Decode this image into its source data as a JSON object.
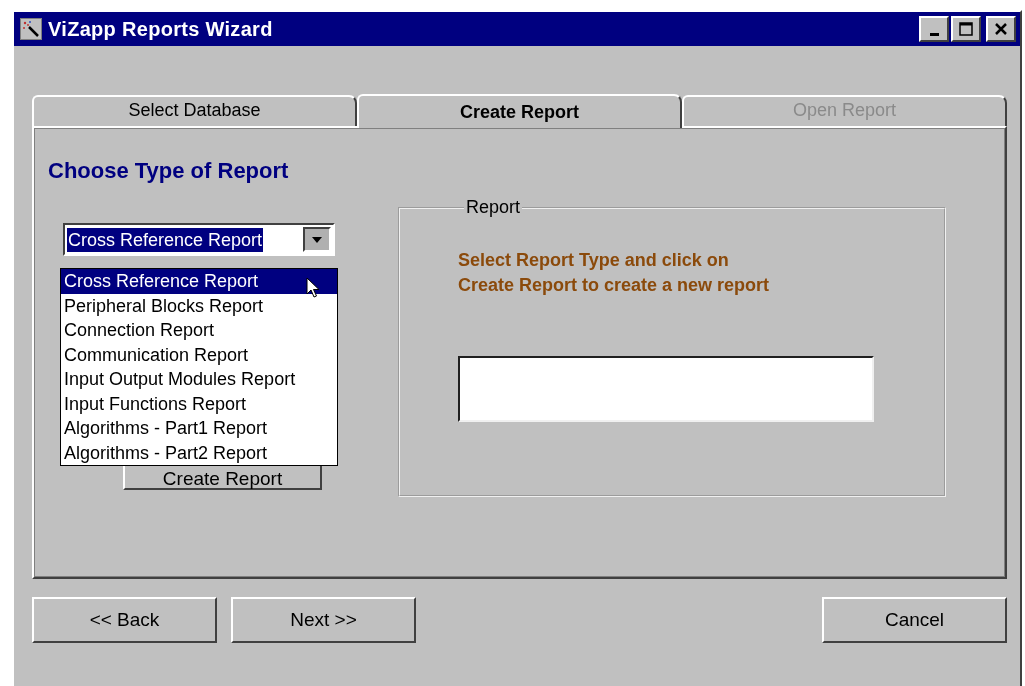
{
  "window": {
    "title": "ViZapp Reports Wizard"
  },
  "tabs": [
    {
      "label": "Select Database",
      "selected": false,
      "disabled": false
    },
    {
      "label": "Create Report",
      "selected": true,
      "disabled": false
    },
    {
      "label": "Open Report",
      "selected": false,
      "disabled": true
    }
  ],
  "heading": "Choose Type of Report",
  "report_type": {
    "value": "Cross Reference Report",
    "expanded": true,
    "options": [
      {
        "label": "Cross Reference Report",
        "selected": true
      },
      {
        "label": "Peripheral Blocks Report",
        "selected": false
      },
      {
        "label": "Connection Report",
        "selected": false
      },
      {
        "label": "Communication Report",
        "selected": false
      },
      {
        "label": "Input Output Modules Report",
        "selected": false
      },
      {
        "label": "Input Functions Report",
        "selected": false
      },
      {
        "label": "Algorithms - Part1 Report",
        "selected": false
      },
      {
        "label": "Algorithms - Part2 Report",
        "selected": false
      }
    ]
  },
  "create_button": "Create Report",
  "report_group": {
    "title": "Report",
    "message": "Select Report Type and click on\nCreate Report to create a new report"
  },
  "buttons": {
    "back": "<< Back",
    "next": "Next >>",
    "cancel": "Cancel"
  }
}
